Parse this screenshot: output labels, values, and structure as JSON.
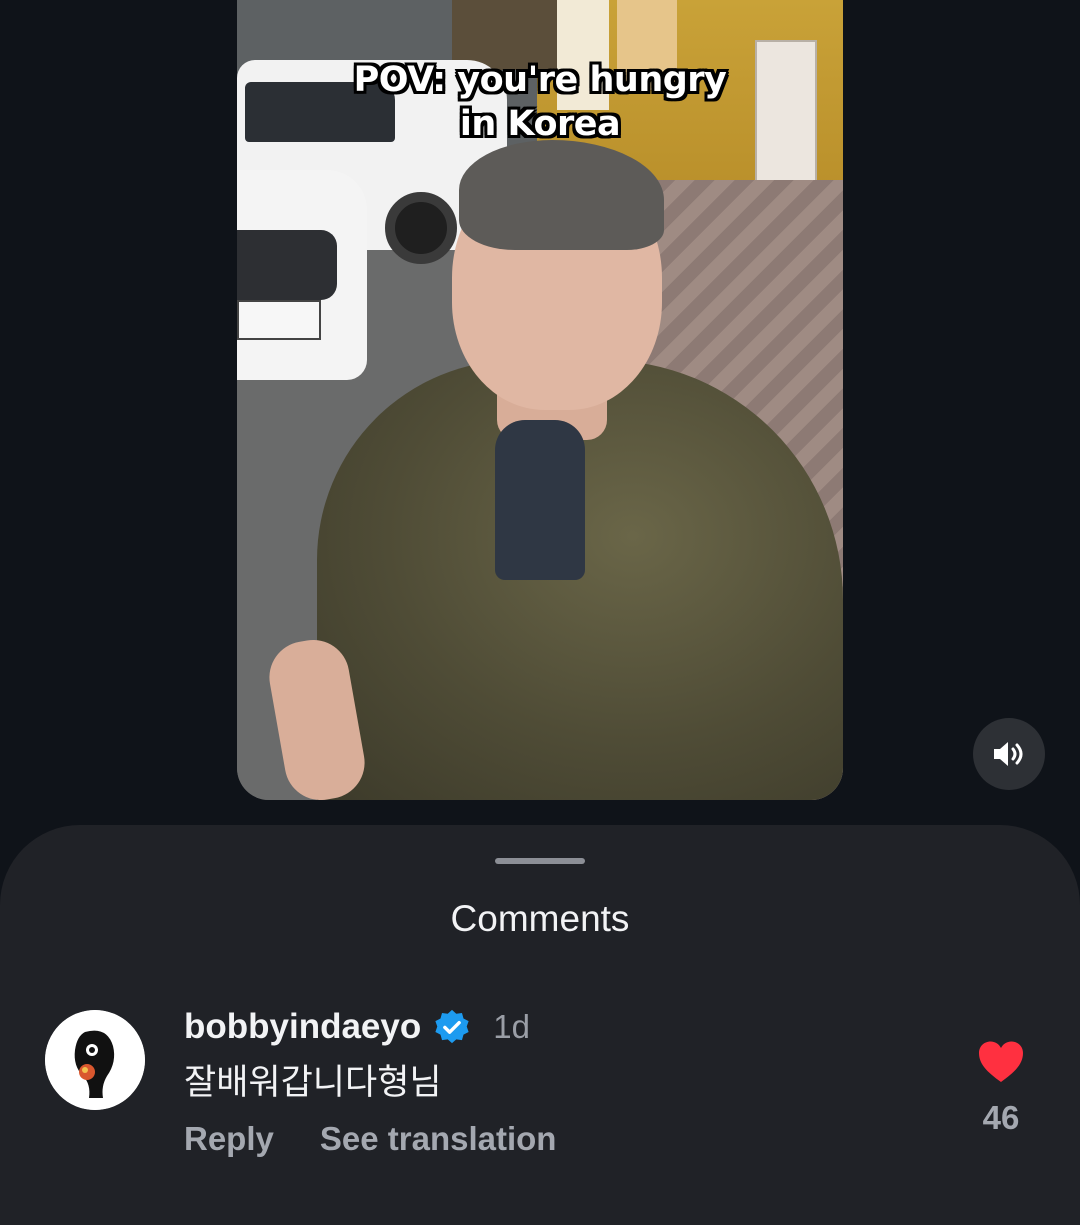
{
  "video": {
    "caption_lines": [
      "POV: you're hungry",
      "in Korea"
    ],
    "sound_icon": "speaker-icon"
  },
  "comments_sheet": {
    "title": "Comments",
    "comments": [
      {
        "username": "bobbyindaeyo",
        "verified": true,
        "verified_icon": "verified-badge-icon",
        "timestamp": "1d",
        "text": "잘배워갑니다형님",
        "reply_label": "Reply",
        "translate_label": "See translation",
        "like_icon": "heart-icon",
        "like_count": "46",
        "liked": true
      }
    ]
  },
  "colors": {
    "background": "#0f1319",
    "sheet": "#202227",
    "heart": "#ff3040",
    "verified": "#1d9bf0",
    "secondary_text": "#a4a8b0"
  }
}
